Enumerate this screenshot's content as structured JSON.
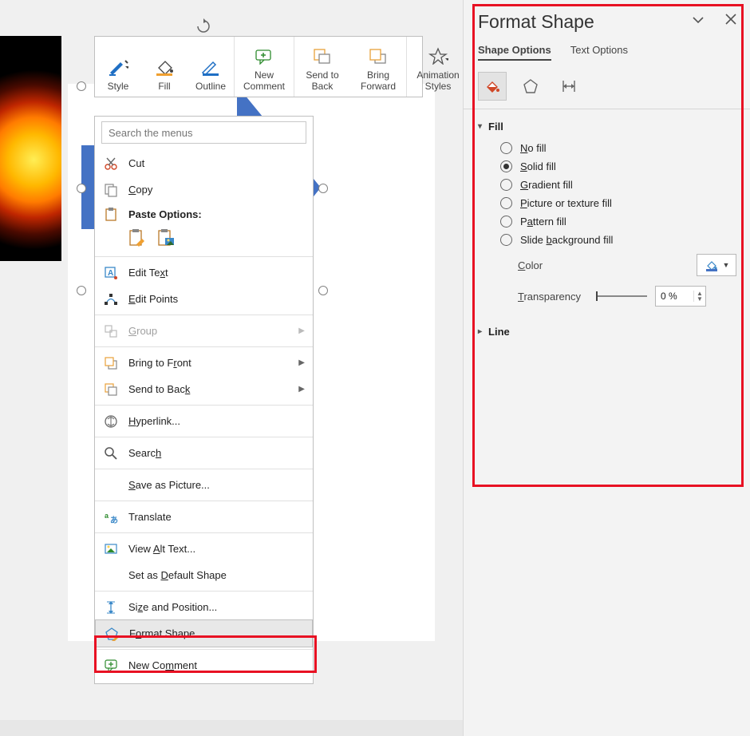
{
  "mini_toolbar": {
    "style": "Style",
    "fill": "Fill",
    "outline": "Outline",
    "new_comment": "New\nComment",
    "send_back": "Send to\nBack",
    "bring_fwd": "Bring\nForward",
    "anim_styles": "Animation\nStyles"
  },
  "context_menu": {
    "search_placeholder": "Search the menus",
    "cut": "Cut",
    "copy": "Copy",
    "paste_header": "Paste Options:",
    "edit_text": "Edit Text",
    "edit_points": "Edit Points",
    "group": "Group",
    "bring_front": "Bring to Front",
    "send_back": "Send to Back",
    "hyperlink": "Hyperlink...",
    "search": "Search",
    "save_picture": "Save as Picture...",
    "translate": "Translate",
    "alt_text": "View Alt Text...",
    "default_shape": "Set as Default Shape",
    "size_pos": "Size and Position...",
    "format_shape": "Format Shape...",
    "new_comment": "New Comment"
  },
  "panel": {
    "title": "Format Shape",
    "tab_shape": "Shape Options",
    "tab_text": "Text Options",
    "fill_section": "Fill",
    "no_fill": "No fill",
    "solid_fill": "Solid fill",
    "gradient_fill": "Gradient fill",
    "picture_fill": "Picture or texture fill",
    "pattern_fill": "Pattern fill",
    "slide_bg_fill": "Slide background fill",
    "color_label": "Color",
    "transparency_label": "Transparency",
    "transparency_value": "0 %",
    "line_section": "Line"
  }
}
